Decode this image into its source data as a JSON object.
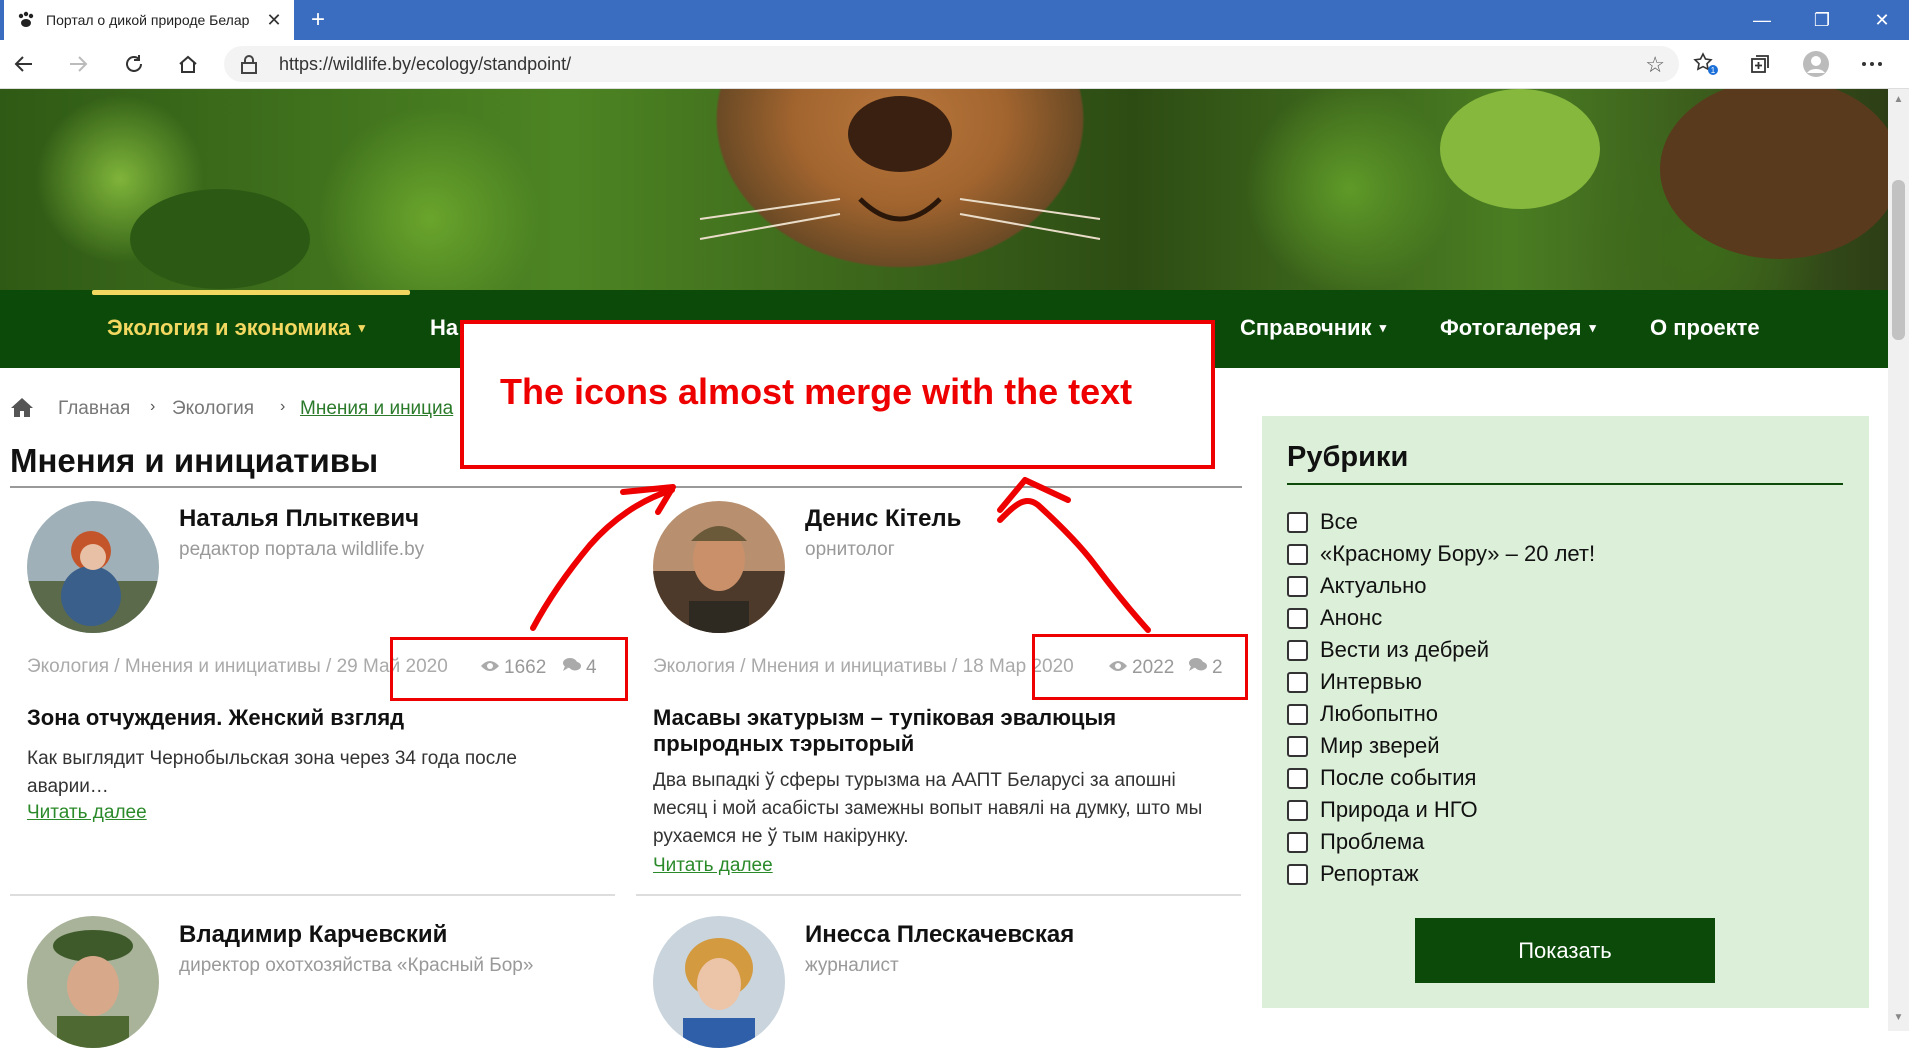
{
  "browser": {
    "tab_title": "Портал о дикой природе Белар",
    "close_glyph": "✕",
    "new_tab_glyph": "+",
    "url": "https://wildlife.by/ecology/standpoint/",
    "window_controls": {
      "minimize": "—",
      "maximize": "❐",
      "close": "✕"
    }
  },
  "nav": {
    "items": [
      "Экология и экономика",
      "На",
      "Справочник",
      "Фотогалерея",
      "О проекте"
    ],
    "caret": "▾"
  },
  "breadcrumb": {
    "home_icon": "home-icon",
    "items": [
      "Главная",
      "Экология",
      "Мнения и инициа"
    ],
    "separator": "›"
  },
  "page_title": "Мнения и инициативы",
  "annotation": {
    "text": "The icons almost merge with the text",
    "color": "#e00000"
  },
  "articles": [
    {
      "author": "Наталья Плыткевич",
      "role": "редактор портала wildlife.by",
      "meta": "Экология / Мнения и инициативы / 29 Май 2020",
      "views": "1662",
      "comments": "4",
      "title": "Зона отчуждения. Женский взгляд",
      "excerpt": "Как выглядит Чернобыльская зона через 34 года после аварии…",
      "read_more": "Читать далее"
    },
    {
      "author": "Денис Кітель",
      "role": "орнитолог",
      "meta": "Экология / Мнения и инициативы / 18 Мар 2020",
      "views": "2022",
      "comments": "2",
      "title": "Масавы экатурызм – тупіковая эвалюцыя прыродных тэрыторый",
      "excerpt": "Два выпадкі ў сферы турызма на ААПТ Беларусі за апошні месяц і мой асабісты замежны вопыт навялі на думку, што мы рухаемся не ў тым накірунку.",
      "read_more": "Читать далее"
    },
    {
      "author": "Владимир Карчевский",
      "role": "директор охотхозяйства «Красный Бор»"
    },
    {
      "author": "Инесса Плескачевская",
      "role": "журналист"
    }
  ],
  "sidebar": {
    "title": "Рубрики",
    "categories": [
      "Все",
      "«Красному Бору» – 20 лет!",
      "Актуально",
      "Анонс",
      "Вести из дебрей",
      "Интервью",
      "Любопытно",
      "Мир зверей",
      "После события",
      "Природа и НГО",
      "Проблема",
      "Репортаж"
    ],
    "button": "Показать"
  },
  "colors": {
    "nav_bg": "#0b4a09",
    "nav_active": "#f2d860",
    "link": "#2a8a2a",
    "sidebar_bg": "#dcefd9"
  }
}
